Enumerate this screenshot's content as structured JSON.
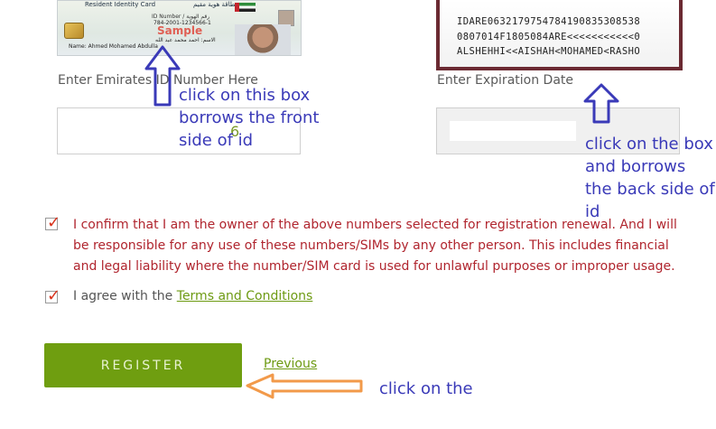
{
  "id_front_card": {
    "header_en": "Resident Identity Card",
    "header_ar": "بطاقة هوية مقيم",
    "id_number_label": "ID Number / رقم الهوية",
    "id_number": "784-2001-1234566-1",
    "watermark": "Sample",
    "name_ar": "الاسم: احمد محمد عبد الله",
    "name_en": "Name: Ahmed Mohamed Abdulla"
  },
  "id_back_card": {
    "mrz_lines": [
      "IDARE0632179754784190835308538",
      "0807014F1805084ARE<<<<<<<<<<<0",
      "ALSHEHHI<<AISHAH<MOHAMED<RASHO"
    ]
  },
  "form": {
    "emirates_id_label": "Enter Emirates ID Number Here",
    "emirates_id_value": "6",
    "expiration_label": "Enter Expiration Date",
    "expiration_value": ""
  },
  "annotations": {
    "front_note": "click on this box borrows the front side of id",
    "back_note": "click on the box and borrows the back side of id",
    "register_note": "click on the",
    "colors": {
      "note_text": "#3a3ab8",
      "up_arrow": "#3a3ab8",
      "left_arrow": "#f29a4a"
    }
  },
  "confirmations": {
    "ownership_text": "I confirm that I am the owner of the above numbers selected for registration renewal. And I will be responsible for any use of these numbers/SIMs by any other person. This includes financial and legal liability where the number/SIM card is used for unlawful purposes or improper usage.",
    "ownership_checked": true,
    "agree_prefix": "I agree with the",
    "terms_link": "Terms and Conditions",
    "agree_checked": true
  },
  "actions": {
    "register_label": "REGISTER",
    "previous_label": "Previous"
  },
  "theme": {
    "accent_green": "#6f9e10",
    "link_green": "#6d9a12",
    "warning_red": "#b0252e",
    "check_red": "#d8331d"
  }
}
